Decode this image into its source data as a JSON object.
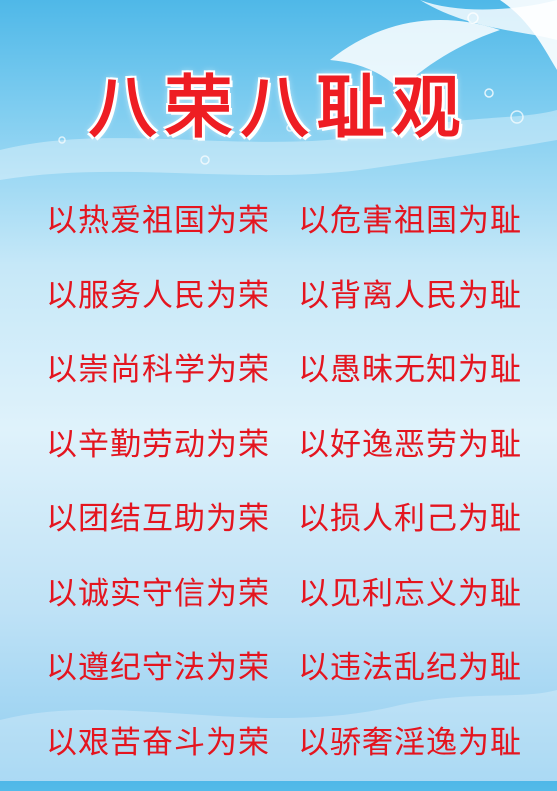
{
  "title": "八荣八耻观",
  "pairs": [
    {
      "honor": "以热爱祖国为荣",
      "shame": "以危害祖国为耻"
    },
    {
      "honor": "以服务人民为荣",
      "shame": "以背离人民为耻"
    },
    {
      "honor": "以崇尚科学为荣",
      "shame": "以愚昧无知为耻"
    },
    {
      "honor": "以辛勤劳动为荣",
      "shame": "以好逸恶劳为耻"
    },
    {
      "honor": "以团结互助为荣",
      "shame": "以损人利己为耻"
    },
    {
      "honor": "以诚实守信为荣",
      "shame": "以见利忘义为耻"
    },
    {
      "honor": "以遵纪守法为荣",
      "shame": "以违法乱纪为耻"
    },
    {
      "honor": "以艰苦奋斗为荣",
      "shame": "以骄奢淫逸为耻"
    }
  ],
  "colors": {
    "text": "#e4151f",
    "title": "#ee1d23",
    "sky": "#7fcdf0"
  }
}
